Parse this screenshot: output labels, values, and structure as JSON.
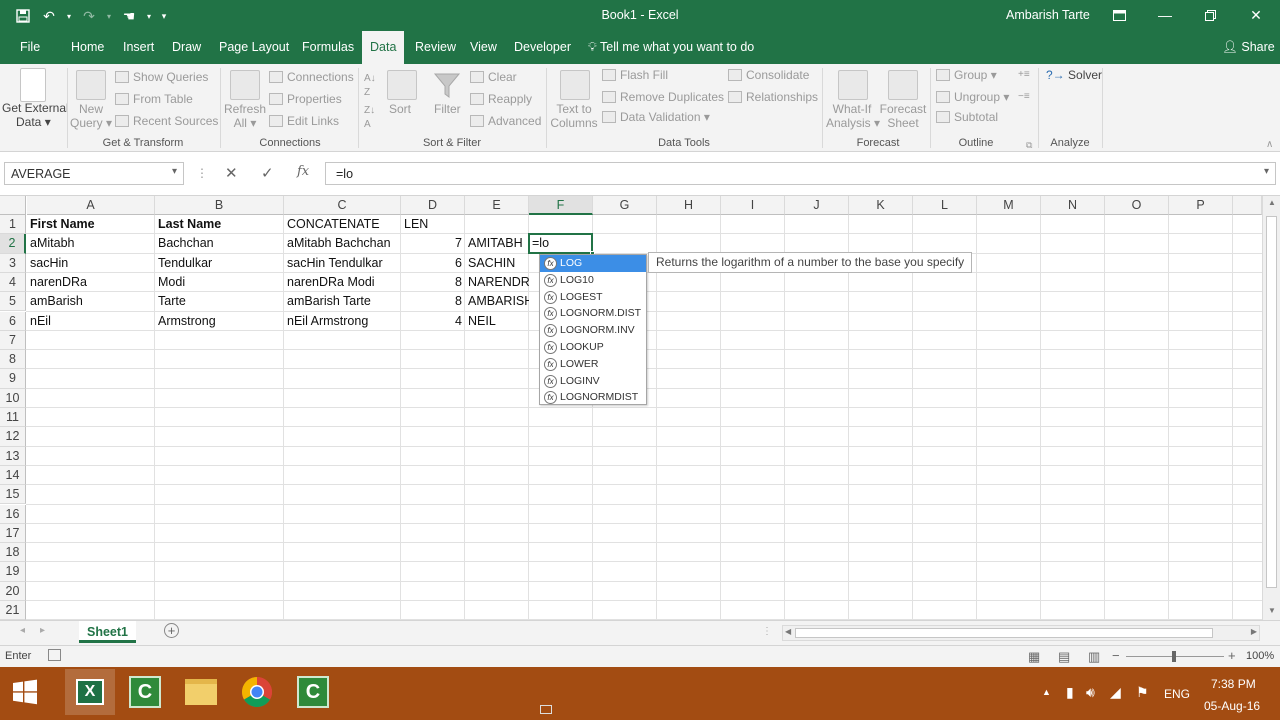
{
  "window": {
    "title": "Book1 - Excel",
    "user": "Ambarish Tarte"
  },
  "tabs": {
    "file": "File",
    "home": "Home",
    "insert": "Insert",
    "draw": "Draw",
    "page_layout": "Page Layout",
    "formulas": "Formulas",
    "data": "Data",
    "review": "Review",
    "view": "View",
    "developer": "Developer",
    "tell_me": "Tell me what you want to do",
    "share": "Share"
  },
  "ribbon": {
    "get_external_data_1": "Get External",
    "get_external_data_2": "Data",
    "new_query_1": "New",
    "new_query_2": "Query",
    "show_queries": "Show Queries",
    "from_table": "From Table",
    "recent_sources": "Recent Sources",
    "group_get_transform": "Get & Transform",
    "refresh_all_1": "Refresh",
    "refresh_all_2": "All",
    "connections": "Connections",
    "properties": "Properties",
    "edit_links": "Edit Links",
    "group_connections": "Connections",
    "sort": "Sort",
    "filter": "Filter",
    "clear": "Clear",
    "reapply": "Reapply",
    "advanced": "Advanced",
    "group_sort_filter": "Sort & Filter",
    "text_to_columns_1": "Text to",
    "text_to_columns_2": "Columns",
    "flash_fill": "Flash Fill",
    "remove_duplicates": "Remove Duplicates",
    "data_validation": "Data Validation",
    "consolidate": "Consolidate",
    "relationships": "Relationships",
    "group_data_tools": "Data Tools",
    "what_if_1": "What-If",
    "what_if_2": "Analysis",
    "forecast_sheet_1": "Forecast",
    "forecast_sheet_2": "Sheet",
    "group_forecast": "Forecast",
    "group": "Group",
    "ungroup": "Ungroup",
    "subtotal": "Subtotal",
    "group_outline": "Outline",
    "solver": "Solver",
    "group_analyze": "Analyze"
  },
  "formula_bar": {
    "name_box": "AVERAGE",
    "cancel": "✕",
    "enter": "✓",
    "fx": "fx",
    "content": "=lo"
  },
  "columns": [
    "A",
    "B",
    "C",
    "D",
    "E",
    "F",
    "G",
    "H",
    "I",
    "J",
    "K",
    "L",
    "M",
    "N",
    "O",
    "P"
  ],
  "rows": [
    "1",
    "2",
    "3",
    "4",
    "5",
    "6",
    "7",
    "8",
    "9",
    "10",
    "11",
    "12",
    "13",
    "14",
    "15",
    "16",
    "17",
    "18",
    "19",
    "20",
    "21"
  ],
  "cells": {
    "A1": "First Name",
    "B1": "Last Name",
    "C1": "CONCATENATE",
    "D1": "LEN",
    "A2": "aMitabh",
    "B2": "Bachchan",
    "C2": "aMitabh Bachchan",
    "D2": "7",
    "E2": "AMITABH",
    "A3": "sacHin",
    "B3": "Tendulkar",
    "C3": "sacHin Tendulkar",
    "D3": "6",
    "E3": "SACHIN",
    "A4": "narenDRa",
    "B4": "Modi",
    "C4": "narenDRa Modi",
    "D4": "8",
    "E4": "NARENDRA",
    "A5": "amBarish",
    "B5": "Tarte",
    "C5": "amBarish Tarte",
    "D5": "8",
    "E5": "AMBARISH",
    "A6": "nEil",
    "B6": "Armstrong",
    "C6": "nEil Armstrong",
    "D6": "4",
    "E6": "NEIL",
    "F2": "=lo"
  },
  "autocomplete": {
    "items": [
      "LOG",
      "LOG10",
      "LOGEST",
      "LOGNORM.DIST",
      "LOGNORM.INV",
      "LOOKUP",
      "LOWER",
      "LOGINV",
      "LOGNORMDIST"
    ],
    "tooltip": "Returns the logarithm of a number to the base you specify"
  },
  "sheets": {
    "active": "Sheet1"
  },
  "status": {
    "mode": "Enter",
    "zoom": "100%"
  },
  "taskbar": {
    "time": "7:38 PM",
    "date": "05-Aug-16",
    "lang": "ENG"
  },
  "colors": {
    "excel_green": "#217346",
    "taskbar": "#a34c12",
    "selection_blue": "#3c8ee6"
  }
}
